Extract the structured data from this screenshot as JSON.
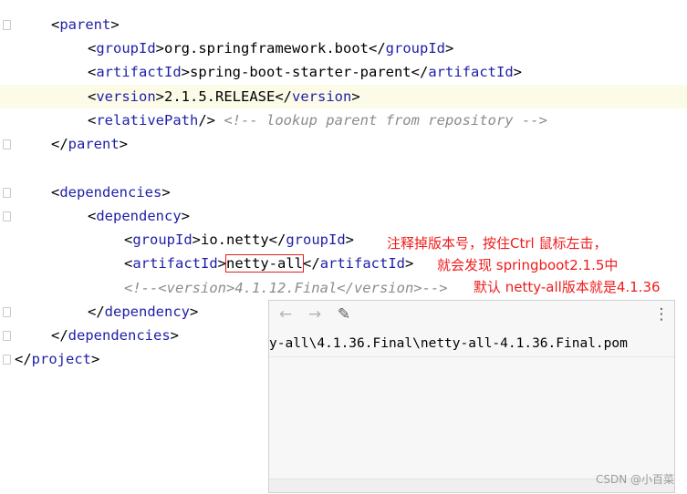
{
  "code": {
    "l1": {
      "open": "<",
      "tag": "parent",
      "close": ">"
    },
    "l2": {
      "tag": "groupId",
      "text": "org.springframework.boot"
    },
    "l3": {
      "tag": "artifactId",
      "text": "spring-boot-starter-parent"
    },
    "l4": {
      "tag": "version",
      "text": "2.1.5.RELEASE"
    },
    "l5": {
      "tag": "relativePath",
      "comment": "<!-- lookup parent from repository -->"
    },
    "l6": {
      "tag": "parent"
    },
    "l7": {
      "tag": "dependencies"
    },
    "l8": {
      "tag": "dependency"
    },
    "l9": {
      "tag": "groupId",
      "text": "io.netty"
    },
    "l10": {
      "tag": "artifactId",
      "text": "netty-all"
    },
    "l11": {
      "comment": "<!--<version>4.1.12.Final</version>-->"
    },
    "l12": {
      "tag": "dependency"
    },
    "l13": {
      "tag": "dependencies"
    },
    "l14": {
      "tag": "project"
    }
  },
  "notes": {
    "line1": "注释掉版本号，按住Ctrl 鼠标左击，",
    "line2": "就会发现 springboot2.1.5中",
    "line3": "默认 netty-all版本就是4.1.36"
  },
  "popup": {
    "back_icon": "←",
    "forward_icon": "→",
    "edit_icon": "✎",
    "more_icon": "⋮",
    "path": "y-all\\4.1.36.Final\\netty-all-4.1.36.Final.pom"
  },
  "watermark": "CSDN @小百菜"
}
